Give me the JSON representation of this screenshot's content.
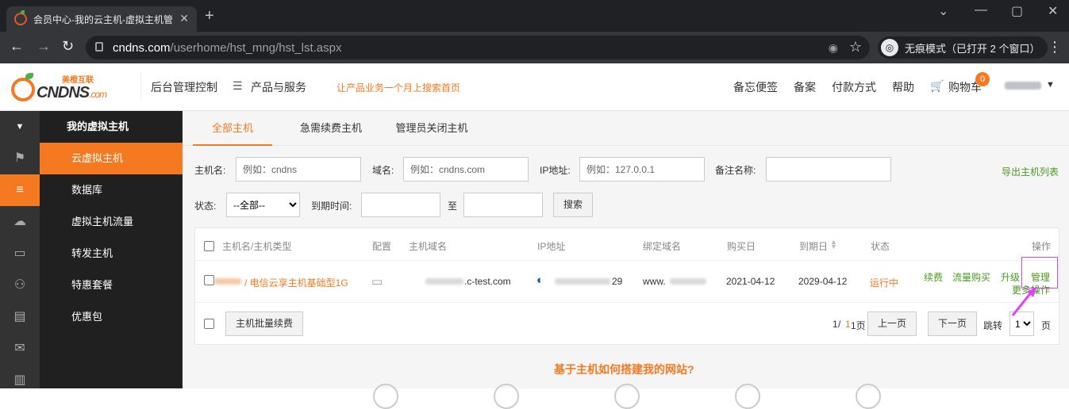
{
  "browser": {
    "tab_title": "会员中心-我的云主机-虚拟主机管",
    "tab_close": "✕",
    "new_tab": "+",
    "url_host": "cndns.com",
    "url_path": "/userhome/hst_mng/hst_lst.aspx",
    "incognito_label": "无痕模式（已打开 2 个窗口）"
  },
  "header": {
    "logo_brand_cn": "美橙互联",
    "logo_brand": "CNDNS",
    "logo_suffix": ".com",
    "nav_console": "后台管理控制",
    "nav_products": "产品与服务",
    "promo": "让产品业务一个月上搜索首页",
    "right_nav": [
      "备忘便签",
      "备案",
      "付款方式",
      "帮助",
      "购物车"
    ],
    "cart_count": "0"
  },
  "sidebar": {
    "title": "我的虚拟主机",
    "items": [
      "云虚拟主机",
      "数据库",
      "虚拟主机流量",
      "转发主机",
      "特惠套餐",
      "优惠包"
    ],
    "active_index": 0
  },
  "tabs": [
    "全部主机",
    "急需续费主机",
    "管理员关闭主机"
  ],
  "filters": {
    "host_label": "主机名:",
    "host_placeholder": "例如：cndns",
    "domain_label": "域名:",
    "domain_placeholder": "例如：cndns.com",
    "ip_label": "IP地址:",
    "ip_placeholder": "例如：127.0.0.1",
    "remark_label": "备注名称:",
    "status_label": "状态:",
    "status_value": "--全部--",
    "expire_label": "到期时间:",
    "to_label": "至",
    "search_button": "搜索",
    "export_link": "导出主机列表"
  },
  "table": {
    "headers": [
      "主机名/主机类型",
      "配置",
      "主机域名",
      "IP地址",
      "绑定域名",
      "购买日",
      "到期日",
      "状态",
      "操作"
    ],
    "row": {
      "host_type": "/ 电信云享主机基础型1G",
      "host_domain_suffix": ".c-test.com",
      "ip_suffix": "29",
      "bind_domain_prefix": "www.",
      "buy_date": "2021-04-12",
      "expire_date": "2029-04-12",
      "status": "运行中",
      "actions": [
        "续费",
        "流量购买",
        "升级",
        "管理"
      ],
      "more_actions": "更多操作"
    },
    "batch_button": "主机批量续费",
    "pager": {
      "current": "1",
      "total": "1页",
      "prev": "上一页",
      "next": "下一页",
      "jump_label": "跳转",
      "jump_value": "1",
      "page_unit": "页"
    }
  },
  "footer_question": "基于主机如何搭建我的网站?"
}
